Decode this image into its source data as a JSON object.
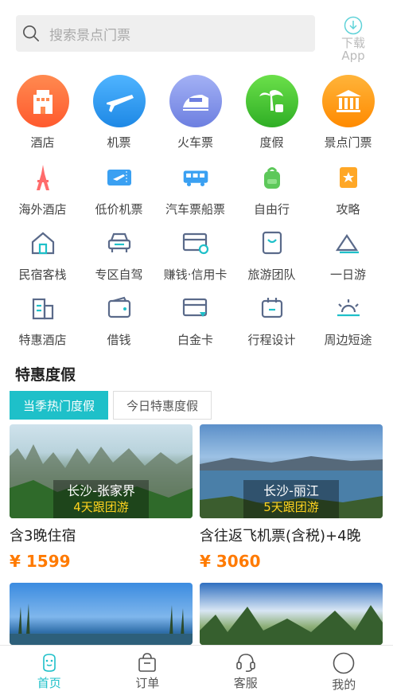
{
  "search": {
    "placeholder": "搜索景点门票"
  },
  "download": {
    "line1": "下载",
    "line2": "App"
  },
  "main_grid": [
    {
      "label": "酒店",
      "icon": "hotel-icon",
      "color": "#ff7043"
    },
    {
      "label": "机票",
      "icon": "airplane-icon",
      "color": "#2196f3"
    },
    {
      "label": "火车票",
      "icon": "train-icon",
      "color": "#7986cb"
    },
    {
      "label": "度假",
      "icon": "palm-tree-icon",
      "color": "#43c234"
    },
    {
      "label": "景点门票",
      "icon": "temple-icon",
      "color": "#ff9b1a"
    }
  ],
  "sub_grid_1": [
    {
      "label": "海外酒店",
      "icon": "eiffel-tower-icon"
    },
    {
      "label": "低价机票",
      "icon": "plane-ticket-icon"
    },
    {
      "label": "汽车票船票",
      "icon": "bus-icon"
    },
    {
      "label": "自由行",
      "icon": "backpack-icon"
    },
    {
      "label": "攻略",
      "icon": "guide-book-icon"
    }
  ],
  "sub_grid_2": [
    {
      "label": "民宿客栈",
      "icon": "house-icon"
    },
    {
      "label": "专区自驾",
      "icon": "car-icon"
    },
    {
      "label": "赚钱·信用卡",
      "icon": "credit-card-icon"
    },
    {
      "label": "旅游团队",
      "icon": "bag-icon"
    },
    {
      "label": "一日游",
      "icon": "mountain-icon"
    }
  ],
  "sub_grid_3": [
    {
      "label": "特惠酒店",
      "icon": "building-icon"
    },
    {
      "label": "借钱",
      "icon": "wallet-icon"
    },
    {
      "label": "白金卡",
      "icon": "platinum-card-icon"
    },
    {
      "label": "行程设计",
      "icon": "itinerary-icon"
    },
    {
      "label": "周边短途",
      "icon": "sunrise-icon"
    }
  ],
  "section": {
    "title": "特惠度假"
  },
  "tabs": [
    {
      "label": "当季热门度假",
      "active": true
    },
    {
      "label": "今日特惠度假",
      "active": false
    }
  ],
  "cards": [
    {
      "dest": "长沙-张家界",
      "days": "4天跟团游",
      "title": "含3晚住宿",
      "price": "¥ 1599"
    },
    {
      "dest": "长沙-丽江",
      "days": "5天跟团游",
      "title": "含往返飞机票(含税)+4晚",
      "price": "¥ 3060"
    }
  ],
  "bottom_nav": [
    {
      "label": "首页",
      "icon": "home-icon"
    },
    {
      "label": "订单",
      "icon": "order-bag-icon"
    },
    {
      "label": "客服",
      "icon": "headset-icon"
    },
    {
      "label": "我的",
      "icon": "profile-icon"
    }
  ],
  "colors": {
    "accent": "#1ec0c9",
    "price": "#ff7a00",
    "badge_days": "#ffd21e"
  }
}
